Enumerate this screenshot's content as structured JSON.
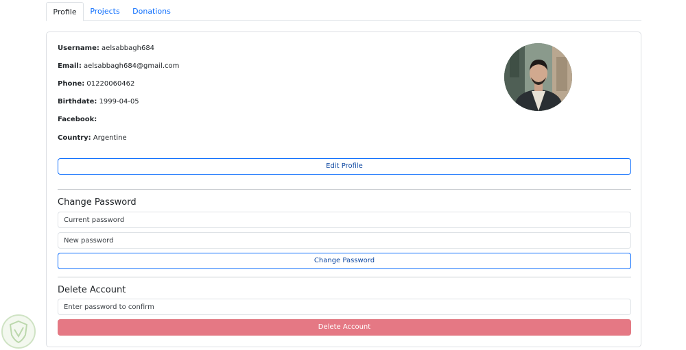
{
  "tabs": [
    {
      "label": "Profile",
      "active": true
    },
    {
      "label": "Projects",
      "active": false
    },
    {
      "label": "Donations",
      "active": false
    }
  ],
  "profile": {
    "username_label": "Username:",
    "username": "aelsabbagh684",
    "email_label": "Email:",
    "email": "aelsabbagh684@gmail.com",
    "phone_label": "Phone:",
    "phone": "01220060462",
    "birthdate_label": "Birthdate:",
    "birthdate": "1999-04-05",
    "facebook_label": "Facebook:",
    "facebook": "",
    "country_label": "Country:",
    "country": "Argentine",
    "edit_button": "Edit Profile"
  },
  "change_password": {
    "title": "Change Password",
    "current_placeholder": "Current password",
    "new_placeholder": "New password",
    "button": "Change Password"
  },
  "delete_account": {
    "title": "Delete Account",
    "confirm_placeholder": "Enter password to confirm",
    "button": "Delete Account"
  },
  "colors": {
    "primary": "#0d6efd",
    "danger": "#e57884",
    "border": "#dee2e6"
  }
}
